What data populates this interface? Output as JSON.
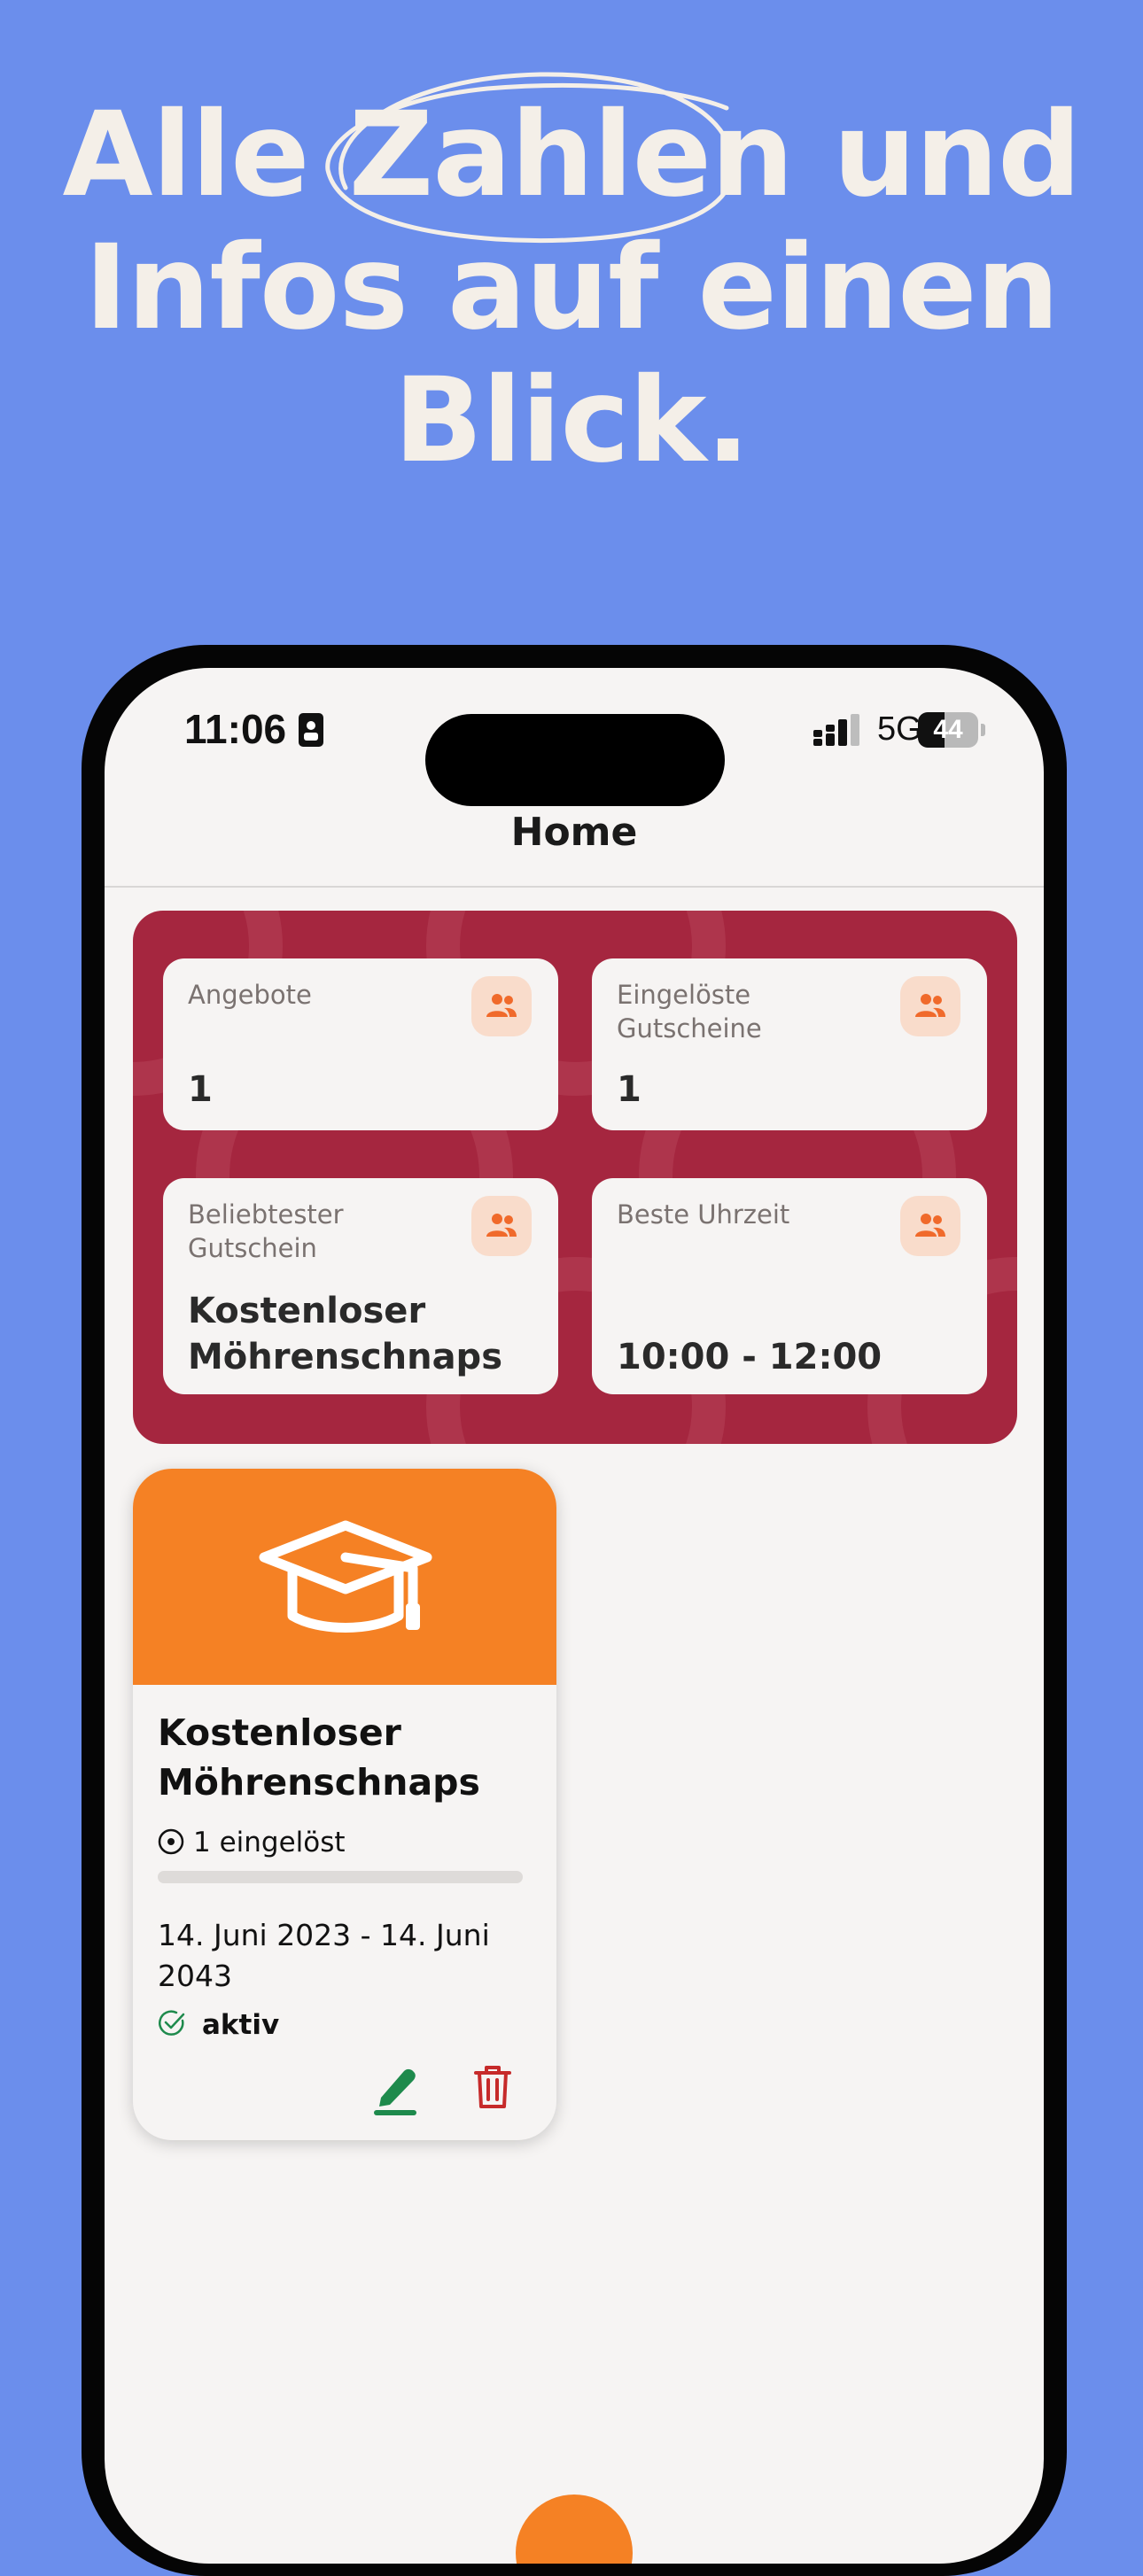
{
  "promo": {
    "headline_lines": [
      "Alle Zahlen und",
      "Infos auf einen",
      "Blick."
    ]
  },
  "status_bar": {
    "time": "11:06",
    "network": "5G",
    "battery": "44",
    "battery_level": 0.44
  },
  "nav": {
    "title": "Home"
  },
  "stats": [
    {
      "label": "Angebote",
      "value": "1",
      "icon": "people-icon"
    },
    {
      "label": "Eingelöste Gutscheine",
      "value": "1",
      "icon": "people-icon"
    },
    {
      "label": "Beliebtester Gutschein",
      "value": "Kostenloser Möhrenschnaps",
      "icon": "people-icon"
    },
    {
      "label": "Beste Uhrzeit",
      "value": "10:00 - 12:00",
      "icon": "people-icon"
    }
  ],
  "voucher": {
    "icon": "graduation-cap-icon",
    "title": "Kostenloser Möhrenschnaps",
    "redeemed_text": "1 eingelöst",
    "progress": 0,
    "dates": "14. Juni 2023 - 14. Juni 2043",
    "status": "aktiv",
    "edit_icon": "pencil-icon",
    "delete_icon": "trash-icon"
  },
  "colors": {
    "background": "#6b8eec",
    "stats_panel": "#a5263f",
    "accent": "#f58124",
    "edit": "#1e8a4c",
    "delete": "#c62a2a"
  }
}
